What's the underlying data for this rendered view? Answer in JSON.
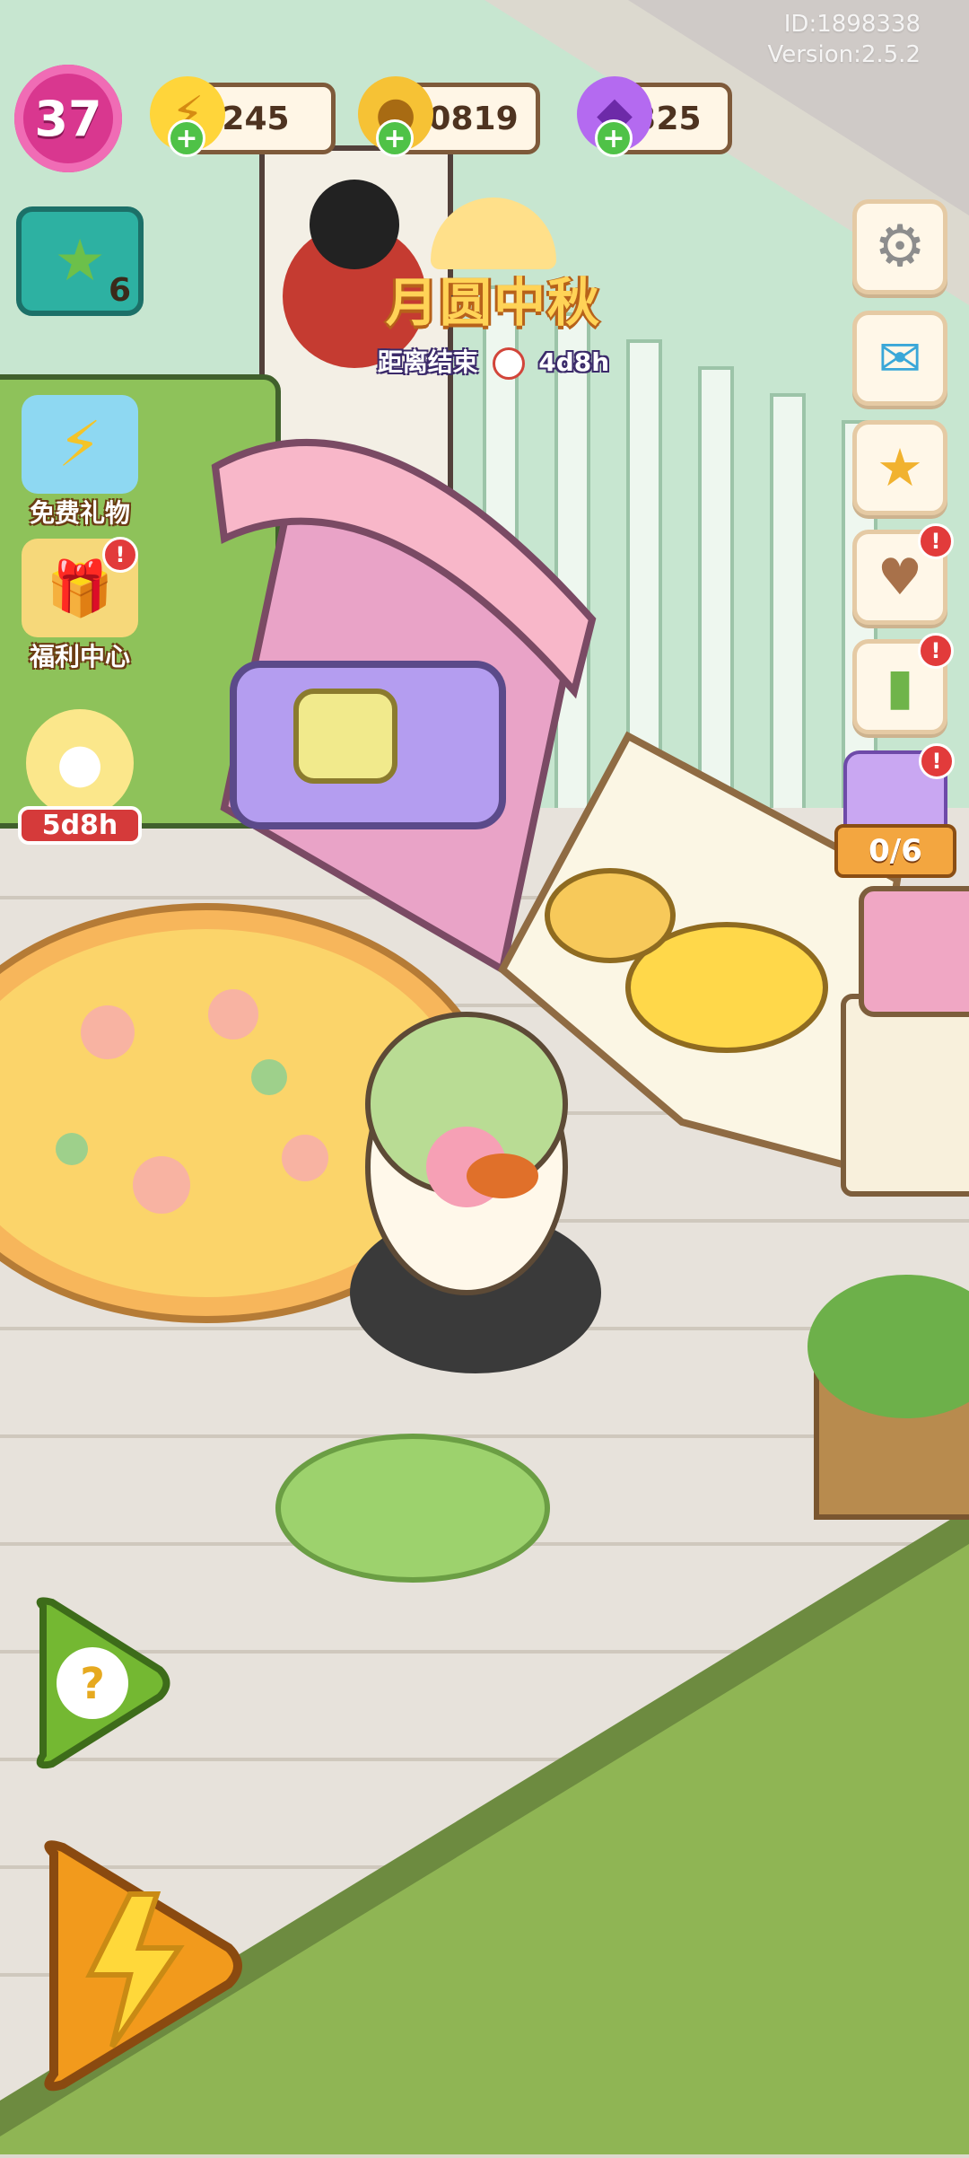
{
  "hud": {
    "id_text": "ID:1898338",
    "version_text": "Version:2.5.2",
    "level": "37",
    "energy": "245",
    "coins": "10819",
    "gems": "325"
  },
  "left_buttons": {
    "task_count": "6",
    "free_gift_label": "免费礼物",
    "welfare_label": "福利中心",
    "bunny_timer": "5d8h"
  },
  "event": {
    "title": "月圆中秋",
    "countdown_label": "距离结束",
    "countdown_value": "4d8h"
  },
  "right_side": {
    "jar_progress": "0/6"
  },
  "bottom_buttons": {
    "help_icon": "question-mark",
    "energy_icon": "lightning"
  },
  "colors": {
    "wall": "#c8e6cf",
    "floor": "#e8e4dc",
    "grass": "#91b653",
    "accent_pink": "#d9378f"
  }
}
